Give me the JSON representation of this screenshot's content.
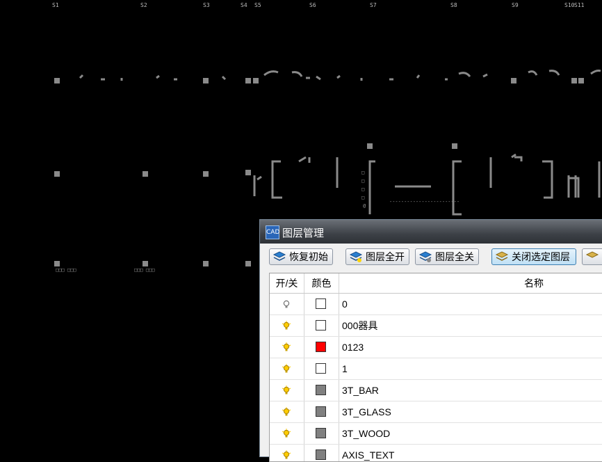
{
  "axis_labels": [
    "S1",
    "S2",
    "S3",
    "S4",
    "S5",
    "S6",
    "S7",
    "S8",
    "S9",
    "S10",
    "S11"
  ],
  "dialog": {
    "title": "图层管理",
    "app_icon_text": "CAD",
    "toolbar": {
      "restore_label": "恢复初始",
      "all_on_label": "图层全开",
      "all_off_label": "图层全关",
      "close_selected_label": "关闭选定图层"
    },
    "columns": {
      "on_off": "开/关",
      "color": "颜色",
      "name": "名称"
    },
    "layers": [
      {
        "name": "0",
        "on": false,
        "color": "#ffffff"
      },
      {
        "name": "000器具",
        "on": true,
        "color": "#ffffff"
      },
      {
        "name": "0123",
        "on": true,
        "color": "#ff0000"
      },
      {
        "name": "1",
        "on": true,
        "color": "#ffffff"
      },
      {
        "name": "3T_BAR",
        "on": true,
        "color": "#808080"
      },
      {
        "name": "3T_GLASS",
        "on": true,
        "color": "#808080"
      },
      {
        "name": "3T_WOOD",
        "on": true,
        "color": "#808080"
      },
      {
        "name": "AXIS_TEXT",
        "on": true,
        "color": "#808080"
      }
    ]
  }
}
